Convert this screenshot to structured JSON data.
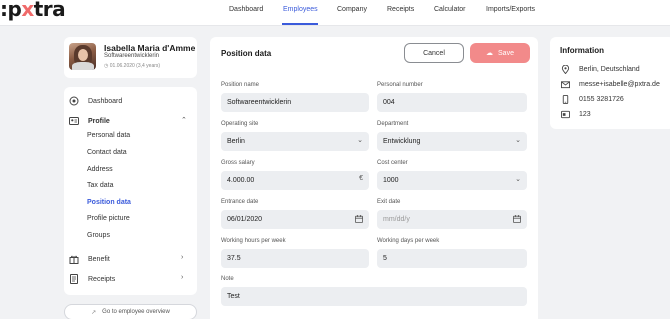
{
  "brand": {
    "logo_prefix": ":p",
    "logo_x": "x",
    "logo_suffix": "tra",
    "accent": "#3b5bdb",
    "save_color": "#f28a8a"
  },
  "nav": {
    "items": [
      "Dashboard",
      "Employees",
      "Company",
      "Receipts",
      "Calculator",
      "Imports/Exports"
    ],
    "active": "Employees"
  },
  "profile": {
    "name": "Isabella Maria d'Amme",
    "role": "Softwareentwicklerin",
    "date": "01.06.2020 (3,4 years)"
  },
  "sidebar": {
    "dashboard": "Dashboard",
    "profile": "Profile",
    "profile_items": [
      "Personal data",
      "Contact data",
      "Address",
      "Tax data",
      "Position data",
      "Profile picture",
      "Groups"
    ],
    "active_item": "Position data",
    "benefit": "Benefit",
    "receipts": "Receipts",
    "goto": "Go to employee overview"
  },
  "main": {
    "title": "Position data",
    "cancel": "Cancel",
    "save": "Save",
    "fields": {
      "position_name": {
        "label": "Position name",
        "value": "Softwareentwicklerin"
      },
      "personal_number": {
        "label": "Personal number",
        "value": "004"
      },
      "operating_site": {
        "label": "Operating site",
        "value": "Berlin"
      },
      "department": {
        "label": "Department",
        "value": "Entwicklung"
      },
      "gross_salary": {
        "label": "Gross salary",
        "value": "4.000.00",
        "unit": "€"
      },
      "cost_center": {
        "label": "Cost center",
        "value": "1000"
      },
      "entrance_date": {
        "label": "Entrance date",
        "value": "06/01/2020"
      },
      "exit_date": {
        "label": "Exit date",
        "placeholder": "mm/dd/y"
      },
      "working_hours": {
        "label": "Working hours per week",
        "value": "37.5"
      },
      "working_days": {
        "label": "Working days per week",
        "value": "5"
      },
      "note": {
        "label": "Note",
        "value": "Test"
      }
    }
  },
  "info": {
    "title": "Information",
    "location": "Berlin, Deutschland",
    "email": "messe+isabelle@pxtra.de",
    "phone": "0155 3281726",
    "id": "123"
  }
}
